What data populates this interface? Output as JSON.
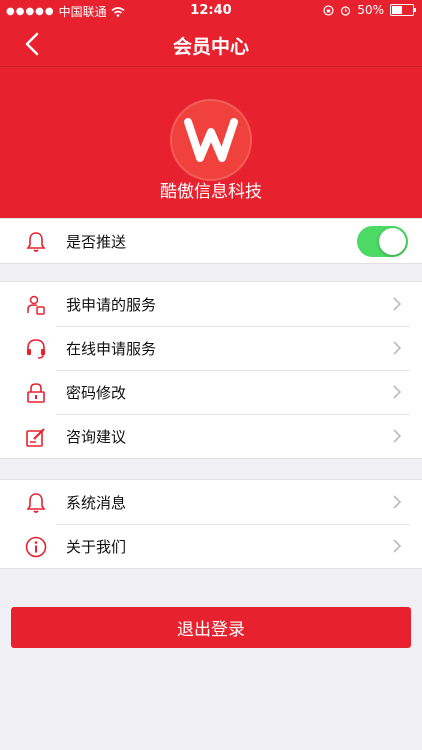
{
  "status_bar": {
    "carrier": "中国联通",
    "time": "12:40",
    "battery": "50%",
    "battery_level": 0.5
  },
  "nav": {
    "title": "会员中心"
  },
  "profile": {
    "company": "酷傲信息科技"
  },
  "push": {
    "label": "是否推送",
    "enabled": true
  },
  "menu_group1": [
    {
      "label": "我申请的服务",
      "icon": "user-doc-icon"
    },
    {
      "label": "在线申请服务",
      "icon": "headset-icon"
    },
    {
      "label": "密码修改",
      "icon": "lock-icon"
    },
    {
      "label": "咨询建议",
      "icon": "edit-icon"
    }
  ],
  "menu_group2": [
    {
      "label": "系统消息",
      "icon": "bell-icon"
    },
    {
      "label": "关于我们",
      "icon": "info-icon"
    }
  ],
  "logout": {
    "label": "退出登录"
  },
  "colors": {
    "accent": "#e8212e",
    "toggle_on": "#4cd964"
  }
}
